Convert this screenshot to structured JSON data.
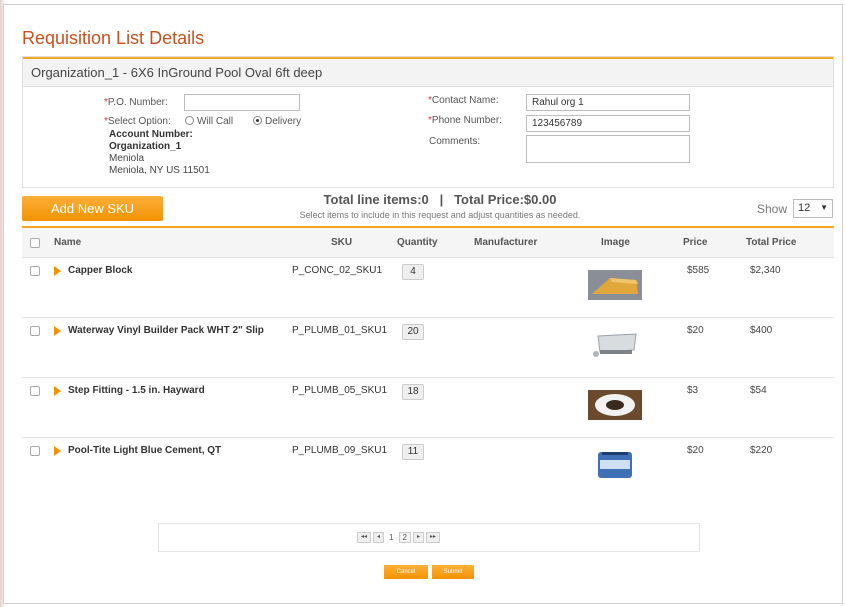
{
  "page": {
    "title": "Requisition List Details"
  },
  "organization": {
    "header": "Organization_1 - 6X6 InGround Pool Oval 6ft deep"
  },
  "form": {
    "po_label": "P.O. Number:",
    "po_value": "",
    "select_option_label": "Select Option:",
    "options": [
      "Will Call",
      "Delivery"
    ],
    "selected_option": "Delivery",
    "account_label": "Account Number:",
    "account_value": "Organization_1",
    "address_line1": "Meniola",
    "address_line2": "Meniola,  NY  US  11501",
    "contact_label": "Contact Name:",
    "contact_value": "Rahul org 1",
    "phone_label": "Phone Number:",
    "phone_value": "123456789",
    "comments_label": "Comments:",
    "comments_value": ""
  },
  "toolbar": {
    "add_sku_label": "Add New SKU",
    "totals_text": "Total line items:0   |   Total Price:$0.00",
    "hint": "Select items to include in this request and adjust quantities as needed.",
    "show_label": "Show",
    "show_value": "12"
  },
  "table": {
    "columns": [
      "Name",
      "SKU",
      "Quantity",
      "Manufacturer",
      "Image",
      "Price",
      "Total Price"
    ],
    "rows": [
      {
        "name": "Capper Block",
        "sku": "P_CONC_02_SKU1",
        "quantity": "4",
        "manufacturer": "",
        "image": "concrete-block-image",
        "price": "$585",
        "total": "$2,340"
      },
      {
        "name": "Waterway Vinyl Builder Pack WHT 2\" Slip",
        "sku": "P_PLUMB_01_SKU1",
        "quantity": "20",
        "manufacturer": "",
        "image": "builder-pack-image",
        "price": "$20",
        "total": "$400"
      },
      {
        "name": "Step Fitting - 1.5 in. Hayward",
        "sku": "P_PLUMB_05_SKU1",
        "quantity": "18",
        "manufacturer": "",
        "image": "step-fitting-image",
        "price": "$3",
        "total": "$54"
      },
      {
        "name": "Pool-Tite Light Blue Cement, QT",
        "sku": "P_PLUMB_09_SKU1",
        "quantity": "11",
        "manufacturer": "",
        "image": "cement-can-image",
        "price": "$20",
        "total": "$220"
      }
    ]
  },
  "pagination": {
    "pages": [
      "1",
      "2"
    ],
    "current": "2"
  },
  "actions": {
    "cancel": "Cancel",
    "submit": "Submit"
  },
  "colors": {
    "accent": "#f39200",
    "title": "#c7511f"
  }
}
